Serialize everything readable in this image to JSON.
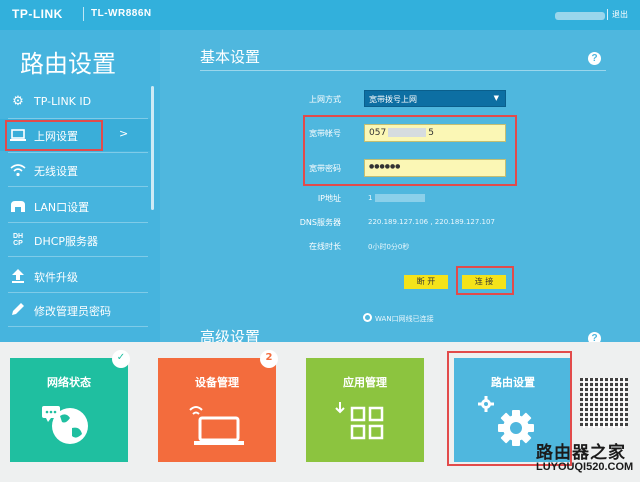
{
  "header": {
    "brand": "TP-LINK",
    "model": "TL-WR886N",
    "logout": "退出"
  },
  "sidebar": {
    "title": "路由设置",
    "items": [
      {
        "label": "TP-LINK ID",
        "icon": "gear-icon"
      },
      {
        "label": "上网设置",
        "icon": "monitor-icon",
        "active": true
      },
      {
        "label": "无线设置",
        "icon": "wifi-icon"
      },
      {
        "label": "LAN口设置",
        "icon": "lan-icon"
      },
      {
        "label": "DHCP服务器",
        "icon": "dhcp-icon"
      },
      {
        "label": "软件升级",
        "icon": "upgrade-icon"
      },
      {
        "label": "修改管理员密码",
        "icon": "pencil-icon"
      }
    ],
    "active_arrow": ">"
  },
  "basic": {
    "title": "基本设置",
    "help": "?",
    "mode_label": "上网方式",
    "mode_value": "宽带拨号上网",
    "account_label": "宽带帐号",
    "account_prefix": "057",
    "account_suffix": "5",
    "password_label": "宽带密码",
    "password_value": "●●●●●●",
    "ip_label": "IP地址",
    "ip_value": "1",
    "dns_label": "DNS服务器",
    "dns_value": "220.189.127.106 , 220.189.127.107",
    "online_label": "在线时长",
    "online_value": "0小时0分0秒",
    "btn_disconnect": "断 开",
    "btn_connect": "连 接",
    "wan_status": "WAN口网线已连接"
  },
  "advanced": {
    "title": "高级设置",
    "help": "?"
  },
  "tiles": [
    {
      "label": "网络状态",
      "color": "#1fbfa0",
      "icon": "globe-icon",
      "badge": "✓"
    },
    {
      "label": "设备管理",
      "color": "#f36c3d",
      "icon": "laptop-icon",
      "badge": "2"
    },
    {
      "label": "应用管理",
      "color": "#8cc43f",
      "icon": "apps-icon"
    },
    {
      "label": "路由设置",
      "color": "#4fb7de",
      "icon": "gear-icon"
    }
  ],
  "watermark": {
    "cn": "路由器之家",
    "url": "LUYOUQI520.COM"
  }
}
